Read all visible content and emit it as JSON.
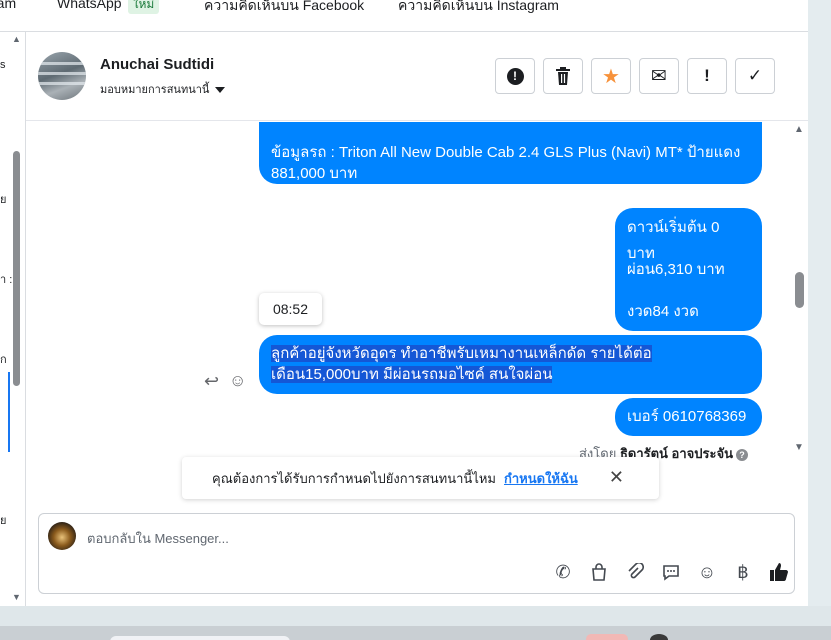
{
  "top_tabs": [
    {
      "label": "ram"
    },
    {
      "label": "WhatsApp",
      "badge": "ใหม่"
    },
    {
      "label": "ความคิดเห็นบน Facebook"
    },
    {
      "label": "ความคิดเห็นบน Instagram"
    }
  ],
  "left_panel": {
    "fragments": [
      "s",
      "ย",
      "า :",
      "ก",
      "ย"
    ]
  },
  "header": {
    "name": "Anuchai Sudtidi",
    "assign_label": "มอบหมายการสนทนานี้",
    "buttons": [
      {
        "icon": "exclamation-circle-icon",
        "glyph": "!"
      },
      {
        "icon": "trash-icon",
        "glyph": "🗑"
      },
      {
        "icon": "star-icon",
        "glyph": "★",
        "color": "#f7923b"
      },
      {
        "icon": "envelope-icon",
        "glyph": "✉"
      },
      {
        "icon": "exclamation-icon",
        "glyph": "!"
      },
      {
        "icon": "check-icon",
        "glyph": "✓"
      }
    ]
  },
  "messages": {
    "msg1": "ข้อมูลรถ : Triton All New Double Cab 2.4 GLS Plus (Navi) MT* ป้ายแดง 881,000 บาท",
    "msg2_lines": [
      "ดาวน์เริ่มต้น 0 บาท",
      "ผ่อน6,310 บาท",
      "งวด84 งวด"
    ],
    "msg3_line1": "ลูกค้าอยู่จังหวัดอุดร ทำอาชีพรับเหมางานเหล็กดัด รายได้ต่อ",
    "msg3_line2": "เดือน15,000บาท มีผ่อนรถมอไซค์ สนใจผ่อน",
    "msg4": "เบอร์ 0610768369",
    "tooltip_time": "08:52",
    "sent_by_prefix": "ส่งโดย",
    "sent_by_name": "ธิดารัตน์ อาจประจัน"
  },
  "notice": {
    "text": "คุณต้องการได้รับการกำหนดไปยังการสนทนานี้ไหม",
    "link": "กำหนดให้ฉัน"
  },
  "composer": {
    "placeholder": "ตอบกลับใน Messenger...",
    "tools": [
      "phone-add-icon",
      "bag-icon",
      "paperclip-icon",
      "chat-bubble-icon",
      "emoji-icon",
      "baht-icon",
      "thumbs-up-icon"
    ]
  },
  "colors": {
    "accent": "#0084ff",
    "link": "#1877f2",
    "highlight": "#1457d6",
    "star": "#f7923b"
  }
}
